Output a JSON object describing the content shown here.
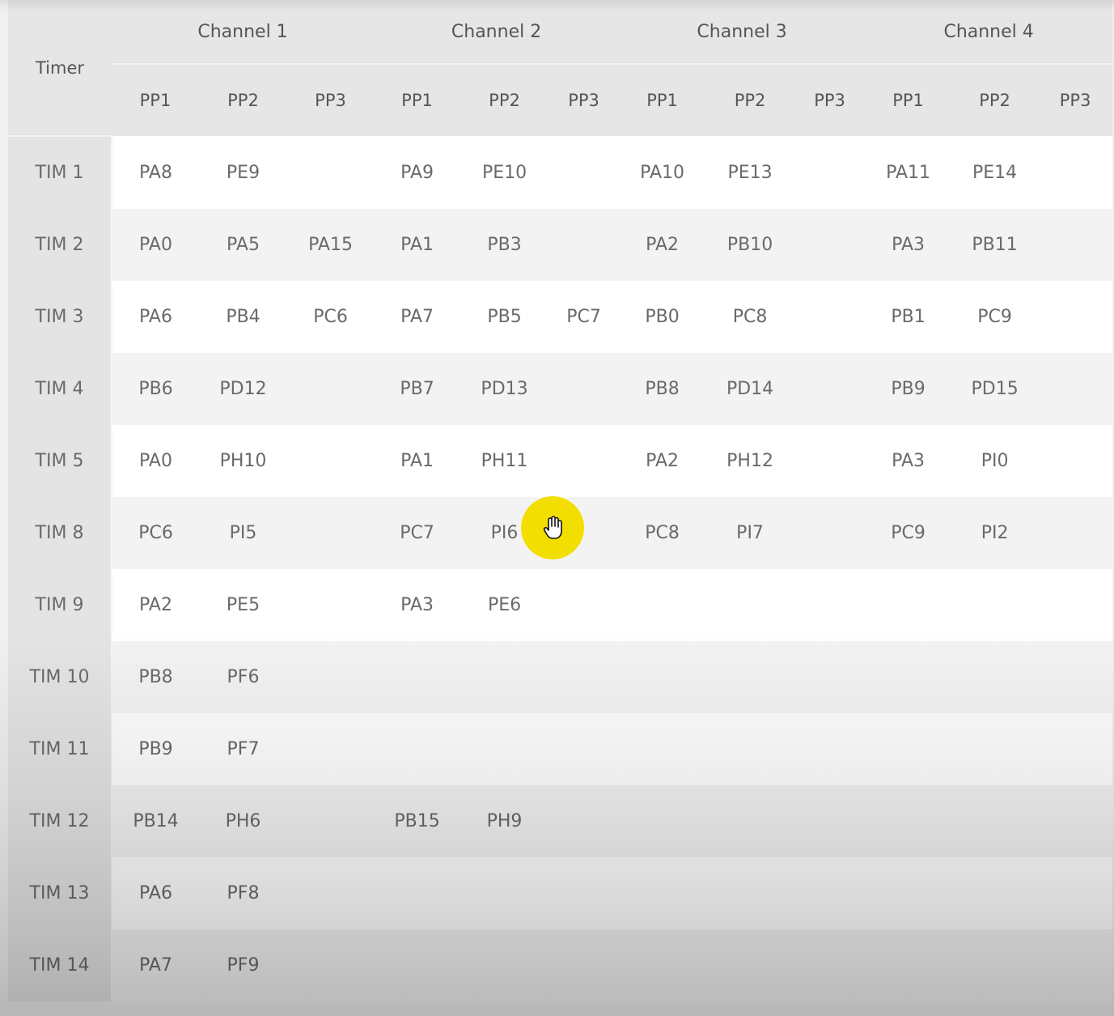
{
  "table": {
    "timer_header": "Timer",
    "channels": [
      "Channel 1",
      "Channel 2",
      "Channel 3",
      "Channel 4"
    ],
    "sub_headers": [
      "PP1",
      "PP2",
      "PP3"
    ],
    "rows": [
      {
        "timer": "TIM 1",
        "pins": [
          "PA8",
          "PE9",
          "",
          "PA9",
          "PE10",
          "",
          "PA10",
          "PE13",
          "",
          "PA11",
          "PE14",
          ""
        ]
      },
      {
        "timer": "TIM 2",
        "pins": [
          "PA0",
          "PA5",
          "PA15",
          "PA1",
          "PB3",
          "",
          "PA2",
          "PB10",
          "",
          "PA3",
          "PB11",
          ""
        ]
      },
      {
        "timer": "TIM 3",
        "pins": [
          "PA6",
          "PB4",
          "PC6",
          "PA7",
          "PB5",
          "PC7",
          "PB0",
          "PC8",
          "",
          "PB1",
          "PC9",
          ""
        ]
      },
      {
        "timer": "TIM 4",
        "pins": [
          "PB6",
          "PD12",
          "",
          "PB7",
          "PD13",
          "",
          "PB8",
          "PD14",
          "",
          "PB9",
          "PD15",
          ""
        ]
      },
      {
        "timer": "TIM 5",
        "pins": [
          "PA0",
          "PH10",
          "",
          "PA1",
          "PH11",
          "",
          "PA2",
          "PH12",
          "",
          "PA3",
          "PI0",
          ""
        ]
      },
      {
        "timer": "TIM 8",
        "pins": [
          "PC6",
          "PI5",
          "",
          "PC7",
          "PI6",
          "",
          "PC8",
          "PI7",
          "",
          "PC9",
          "PI2",
          ""
        ]
      },
      {
        "timer": "TIM 9",
        "pins": [
          "PA2",
          "PE5",
          "",
          "PA3",
          "PE6",
          "",
          "",
          "",
          "",
          "",
          "",
          ""
        ]
      },
      {
        "timer": "TIM 10",
        "pins": [
          "PB8",
          "PF6",
          "",
          "",
          "",
          "",
          "",
          "",
          "",
          "",
          "",
          ""
        ]
      },
      {
        "timer": "TIM 11",
        "pins": [
          "PB9",
          "PF7",
          "",
          "",
          "",
          "",
          "",
          "",
          "",
          "",
          "",
          ""
        ]
      },
      {
        "timer": "TIM 12",
        "pins": [
          "PB14",
          "PH6",
          "",
          "PB15",
          "PH9",
          "",
          "",
          "",
          "",
          "",
          "",
          ""
        ]
      },
      {
        "timer": "TIM 13",
        "pins": [
          "PA6",
          "PF8",
          "",
          "",
          "",
          "",
          "",
          "",
          "",
          "",
          "",
          ""
        ]
      },
      {
        "timer": "TIM 14",
        "pins": [
          "PA7",
          "PF9",
          "",
          "",
          "",
          "",
          "",
          "",
          "",
          "",
          "",
          ""
        ]
      }
    ]
  },
  "cursor": {
    "icon": "hand-pointer-icon",
    "highlight_color": "#f2de00"
  },
  "colors": {
    "header_bg": "#e6e6e6",
    "row_white": "#ffffff",
    "row_alt": "#f3f3f3",
    "label_col_bg": "#e4e4e4",
    "text": "#6a6a6a"
  }
}
